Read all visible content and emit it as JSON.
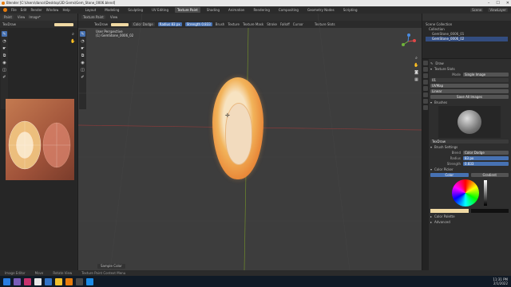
{
  "window": {
    "title": "Blender [C:\\Users\\dancs\\Desktop\\3D Gems\\Gem_Stone_0006.blend]",
    "controls": [
      "–",
      "☐",
      "✕"
    ]
  },
  "menubar": {
    "menus": [
      "File",
      "Edit",
      "Render",
      "Window",
      "Help"
    ],
    "tabs": [
      "Layout",
      "Modeling",
      "Sculpting",
      "UV Editing",
      "Texture Paint",
      "Shading",
      "Animation",
      "Rendering",
      "Compositing",
      "Geometry Nodes",
      "Scripting"
    ],
    "active_tab": "Texture Paint",
    "scene": "Scene",
    "view_layer": "ViewLayer"
  },
  "image_editor": {
    "header": [
      "Paint",
      "View",
      "Image*"
    ],
    "tool_name": "TexDraw",
    "tools": [
      "draw-icon",
      "soften-icon",
      "smear-icon",
      "clone-icon",
      "fill-icon",
      "mask-icon",
      "annotate-icon"
    ]
  },
  "viewport": {
    "header": [
      "Texture Paint",
      "View"
    ],
    "tool_name": "TexDraw",
    "blend": "Color Dodge",
    "radius_label": "Radius",
    "radius_value": "83 px",
    "strength_label": "Strength",
    "strength_value": "0.833",
    "menus": [
      "Brush",
      "Texture",
      "Texture Mask",
      "Stroke",
      "Falloff",
      "Cursor"
    ],
    "texture_slots": "Texture Slots",
    "perspective": "User Perspective",
    "object_name": "(1) GemStone_0006_02",
    "footer_hint": "Sample Color"
  },
  "outliner": {
    "title": "Scene Collection",
    "items": [
      "Collection",
      "GemStone_0006_01",
      "GemStone_0006_02"
    ]
  },
  "properties": {
    "tool": "Draw",
    "texture_slots_label": "Texture Slots",
    "mode_label": "Mode",
    "mode_value": "Single Image",
    "image_value": "01",
    "uvmap_value": "UVMap",
    "interp_value": "Linear",
    "save_all": "Save All Images",
    "brushes_label": "Brushes",
    "brush_name": "TexDraw",
    "brush_settings_label": "Brush Settings",
    "blend_label": "Blend",
    "blend_value": "Color Dodge",
    "radius_label": "Radius",
    "radius_value": "83 px",
    "strength_label": "Strength",
    "strength_value": "0.833",
    "color_picker_label": "Color Picker",
    "color_tab": "Color",
    "gradient_tab": "Gradient",
    "color_palette": "Color Palette",
    "advanced": "Advanced",
    "swatch_color": "#f0d9a3"
  },
  "statusbar": [
    "Image Editor",
    "Move",
    "Rotate View",
    "Texture Paint Context Menu"
  ],
  "taskbar": {
    "time": "11:31 PM",
    "date": "2/1/2022"
  },
  "colors": {
    "accent": "#4772b3",
    "gem": "#e98a3a"
  }
}
